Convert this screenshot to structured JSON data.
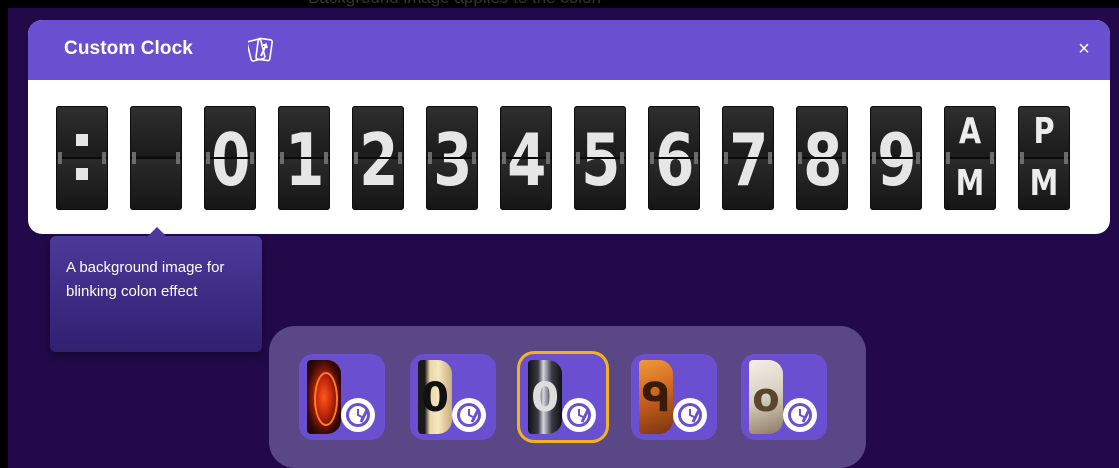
{
  "header": {
    "top_caption": "Background image applies to the colon",
    "title": "Custom Clock",
    "panel_icon": "cards-icon",
    "close_label": "×"
  },
  "tiles": [
    {
      "kind": "colon",
      "label": ":"
    },
    {
      "kind": "blank",
      "label": ""
    },
    {
      "kind": "digit",
      "label": "0"
    },
    {
      "kind": "digit",
      "label": "1"
    },
    {
      "kind": "digit",
      "label": "2"
    },
    {
      "kind": "digit",
      "label": "3"
    },
    {
      "kind": "digit",
      "label": "4"
    },
    {
      "kind": "digit",
      "label": "5"
    },
    {
      "kind": "digit",
      "label": "6"
    },
    {
      "kind": "digit",
      "label": "7"
    },
    {
      "kind": "digit",
      "label": "8"
    },
    {
      "kind": "digit",
      "label": "9"
    },
    {
      "kind": "ampm",
      "top": "A",
      "bottom": "M"
    },
    {
      "kind": "ampm",
      "top": "P",
      "bottom": "M"
    }
  ],
  "tooltip": {
    "text": "A background image for blinking colon effect"
  },
  "themes": [
    {
      "name": "nixie",
      "selected": false
    },
    {
      "name": "classic",
      "selected": false
    },
    {
      "name": "flip",
      "selected": true
    },
    {
      "name": "wood",
      "selected": false
    },
    {
      "name": "vintage",
      "selected": false
    }
  ],
  "colors": {
    "accent": "#6a50d0",
    "background": "#220a4a",
    "selected_border": "#f2b41e",
    "tray": "#5a4886"
  }
}
